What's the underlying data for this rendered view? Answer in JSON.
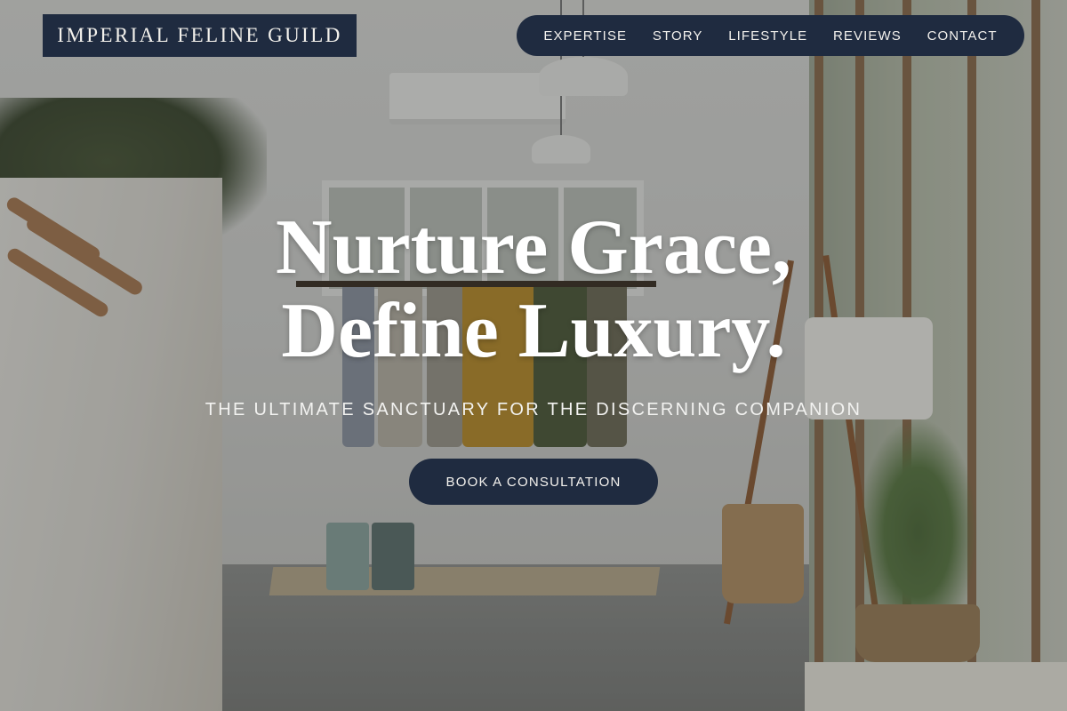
{
  "brand": {
    "name": "IMPERIAL FELINE GUILD"
  },
  "nav": {
    "items": [
      {
        "label": "EXPERTISE"
      },
      {
        "label": "STORY"
      },
      {
        "label": "LIFESTYLE"
      },
      {
        "label": "REVIEWS"
      },
      {
        "label": "CONTACT"
      }
    ]
  },
  "hero": {
    "title_line1": "Nurture Grace,",
    "title_line2": "Define Luxury.",
    "subtitle": "THE ULTIMATE SANCTUARY FOR THE DISCERNING COMPANION",
    "cta_label": "BOOK A CONSULTATION"
  },
  "colors": {
    "navy": "#1f2b40",
    "text_light": "#f4f2ee"
  }
}
